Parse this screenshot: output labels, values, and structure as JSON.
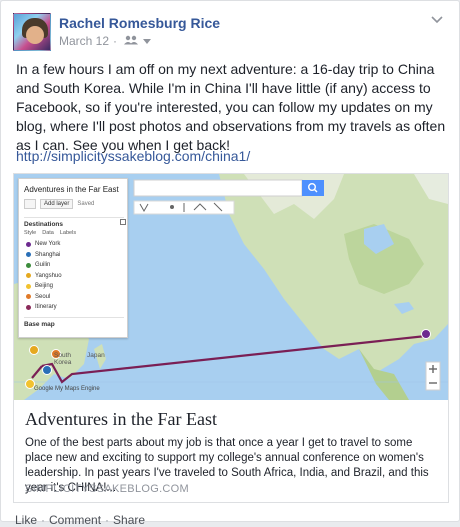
{
  "post": {
    "author": "Rachel Romesburg Rice",
    "date": "March 12",
    "audience_icon": "friends-icon",
    "text": "In a few hours I am off on my next adventure: a 16-day trip to China and South Korea. While I'm in China I'll have little (if any) access to Facebook, so if you're interested, you can follow my updates on my blog, where I'll post photos and observations from my travels as often as I can. See you when I get back!",
    "link": "http://simplicityssakeblog.com/china1/"
  },
  "preview": {
    "title": "Adventures in the Far East",
    "description": "One of the best parts about my job is that once a year I get to travel to some place new and exciting to support my college's annual conference on women's leadership. In past years I've traveled to South Africa, India, and Brazil, and this year it's CHINA!...",
    "domain": "SIMPLICITYSSAKEBLOG.COM",
    "map": {
      "panel_title": "Adventures in the Far East",
      "add_layer": "Add layer",
      "saved": "Saved",
      "destinations_label": "Destinations",
      "style_label": "Style",
      "data_label": "Data",
      "labels_label": "Labels",
      "destinations": [
        {
          "name": "New York",
          "color": "#6d2a8f"
        },
        {
          "name": "Shanghai",
          "color": "#2a6fb7"
        },
        {
          "name": "Guilin",
          "color": "#3c8c3c"
        },
        {
          "name": "Yangshuo",
          "color": "#e5a91f"
        },
        {
          "name": "Beijing",
          "color": "#f2c22f"
        },
        {
          "name": "Seoul",
          "color": "#e07a28"
        },
        {
          "name": "Itinerary",
          "color": "#8a2a5a"
        }
      ],
      "basemap_label": "Base map",
      "footer_label": "Google My Maps Engine",
      "place_labels": {
        "south_korea": "South Korea",
        "japan": "Japan"
      }
    }
  },
  "actions": {
    "like": "Like",
    "comment": "Comment",
    "share": "Share",
    "separator": "·"
  },
  "colors": {
    "link": "#365899",
    "meta": "#90949c",
    "route": "#7a1f55"
  }
}
